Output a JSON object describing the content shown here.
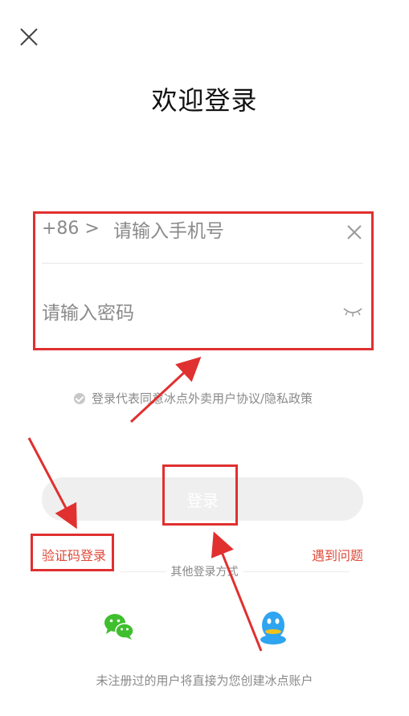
{
  "title": "欢迎登录",
  "phone": {
    "country_code": "+86  >",
    "placeholder": "请输入手机号"
  },
  "password": {
    "placeholder": "请输入密码"
  },
  "agreement": "登录代表同意冰点外卖用户协议/隐私政策",
  "login_button": "登录",
  "sms_login": "验证码登录",
  "help": "遇到问题",
  "other_methods": "其他登录方式",
  "footer": "未注册过的用户将直接为您创建冰点账户",
  "colors": {
    "accent_red": "#e04a3a",
    "annotation_red": "#e03030",
    "wechat_green": "#3fbf2e",
    "qq_blue": "#2fa4f0"
  }
}
